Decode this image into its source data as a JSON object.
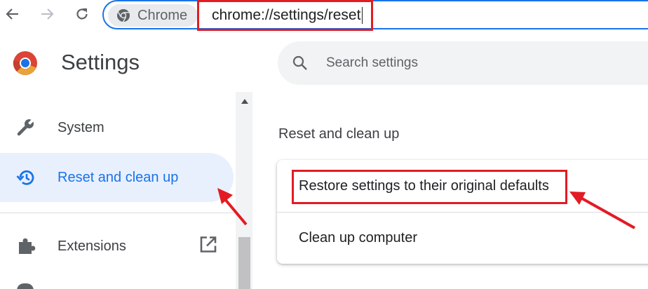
{
  "browser": {
    "back_icon": "back-arrow-icon",
    "forward_icon": "forward-arrow-icon",
    "reload_icon": "reload-icon",
    "site_chip_label": "Chrome",
    "url": "chrome://settings/reset"
  },
  "sidebar": {
    "app_title": "Settings",
    "items": [
      {
        "label": "System",
        "icon": "wrench-icon",
        "active": false
      },
      {
        "label": "Reset and clean up",
        "icon": "restore-history-icon",
        "active": true
      },
      {
        "label": "Extensions",
        "icon": "puzzle-piece-icon",
        "active": false,
        "trailing_icon": "open-in-new-icon"
      }
    ]
  },
  "search": {
    "placeholder": "Search settings"
  },
  "main": {
    "section_title": "Reset and clean up",
    "options": [
      {
        "label": "Restore settings to their original defaults"
      },
      {
        "label": "Clean up computer"
      }
    ]
  },
  "colors": {
    "accent": "#1a73e8",
    "active_bg": "#e8f0fe",
    "annotation_red": "#e31b23"
  }
}
